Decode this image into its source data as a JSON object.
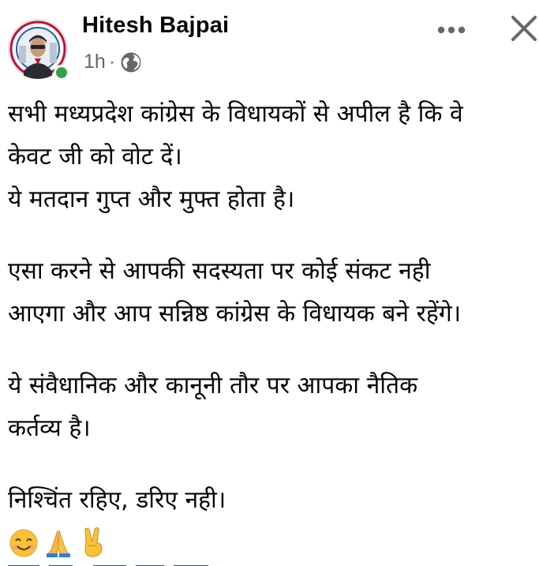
{
  "post": {
    "author_name": "Hitesh Bajpai",
    "timestamp": "1h",
    "separator": "·",
    "audience_icon": "globe-icon",
    "online": true,
    "more_icon": "more-horizontal-icon",
    "close_icon": "close-icon"
  },
  "body": {
    "lines": [
      "सभी मध्यप्रदेश कांग्रेस के विधायकों से अपील है कि वे",
      "केवट जी को वोट दें।",
      "ये मतदान गुप्त और मुफ्त होता है।",
      "",
      "एसा करने से आपकी सदस्यता पर कोई संकट नही",
      "आएगा और आप सन्निष्ठ कांग्रेस के विधायक बने रहेंगे।",
      "",
      "ये संवैधानिक और कानूनी तौर पर आपका नैतिक",
      "कर्तव्य है।",
      "",
      "निश्चिंत रहिए, डरिए नही।"
    ],
    "emojis": [
      "smiling-face-emoji",
      "folded-hands-emoji",
      "victory-hand-emoji"
    ]
  },
  "colors": {
    "online_dot": "#31a24c",
    "meta_text": "#65676b",
    "icon_gray": "#65676b",
    "text": "#050505"
  }
}
